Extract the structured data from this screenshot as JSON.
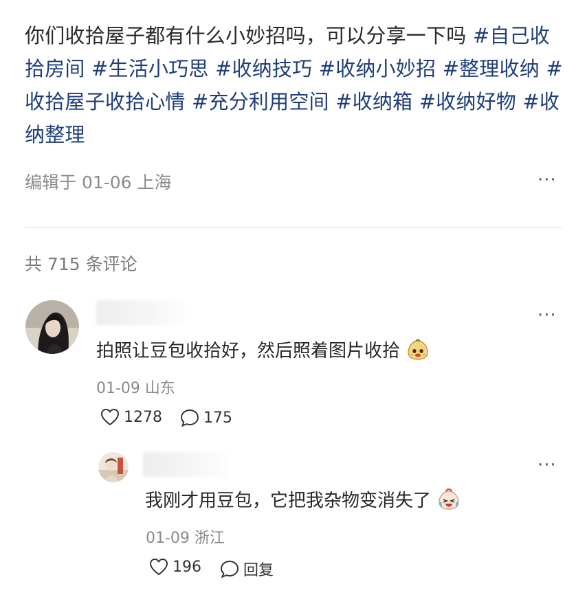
{
  "post": {
    "text": "你们收拾屋子都有什么小妙招吗，可以分享一下吗",
    "tags": [
      "#自己收拾房间",
      "#生活小巧思",
      "#收纳技巧",
      "#收纳小妙招",
      "#整理收纳",
      "#收拾屋子收拾心情",
      "#充分利用空间",
      "#收纳箱",
      "#收纳好物",
      "#收纳整理"
    ],
    "meta": "编辑于 01-06 上海"
  },
  "comments_count": "共 715 条评论",
  "comment": {
    "text": "拍照让豆包收拾好，然后照着图片收拾",
    "meta": "01-09 山东",
    "likes": "1278",
    "replies": "175"
  },
  "reply": {
    "text": "我刚才用豆包，它把我杂物变消失了",
    "meta": "01-09 浙江",
    "likes": "196",
    "reply_label": "回复"
  },
  "more_label": "···"
}
